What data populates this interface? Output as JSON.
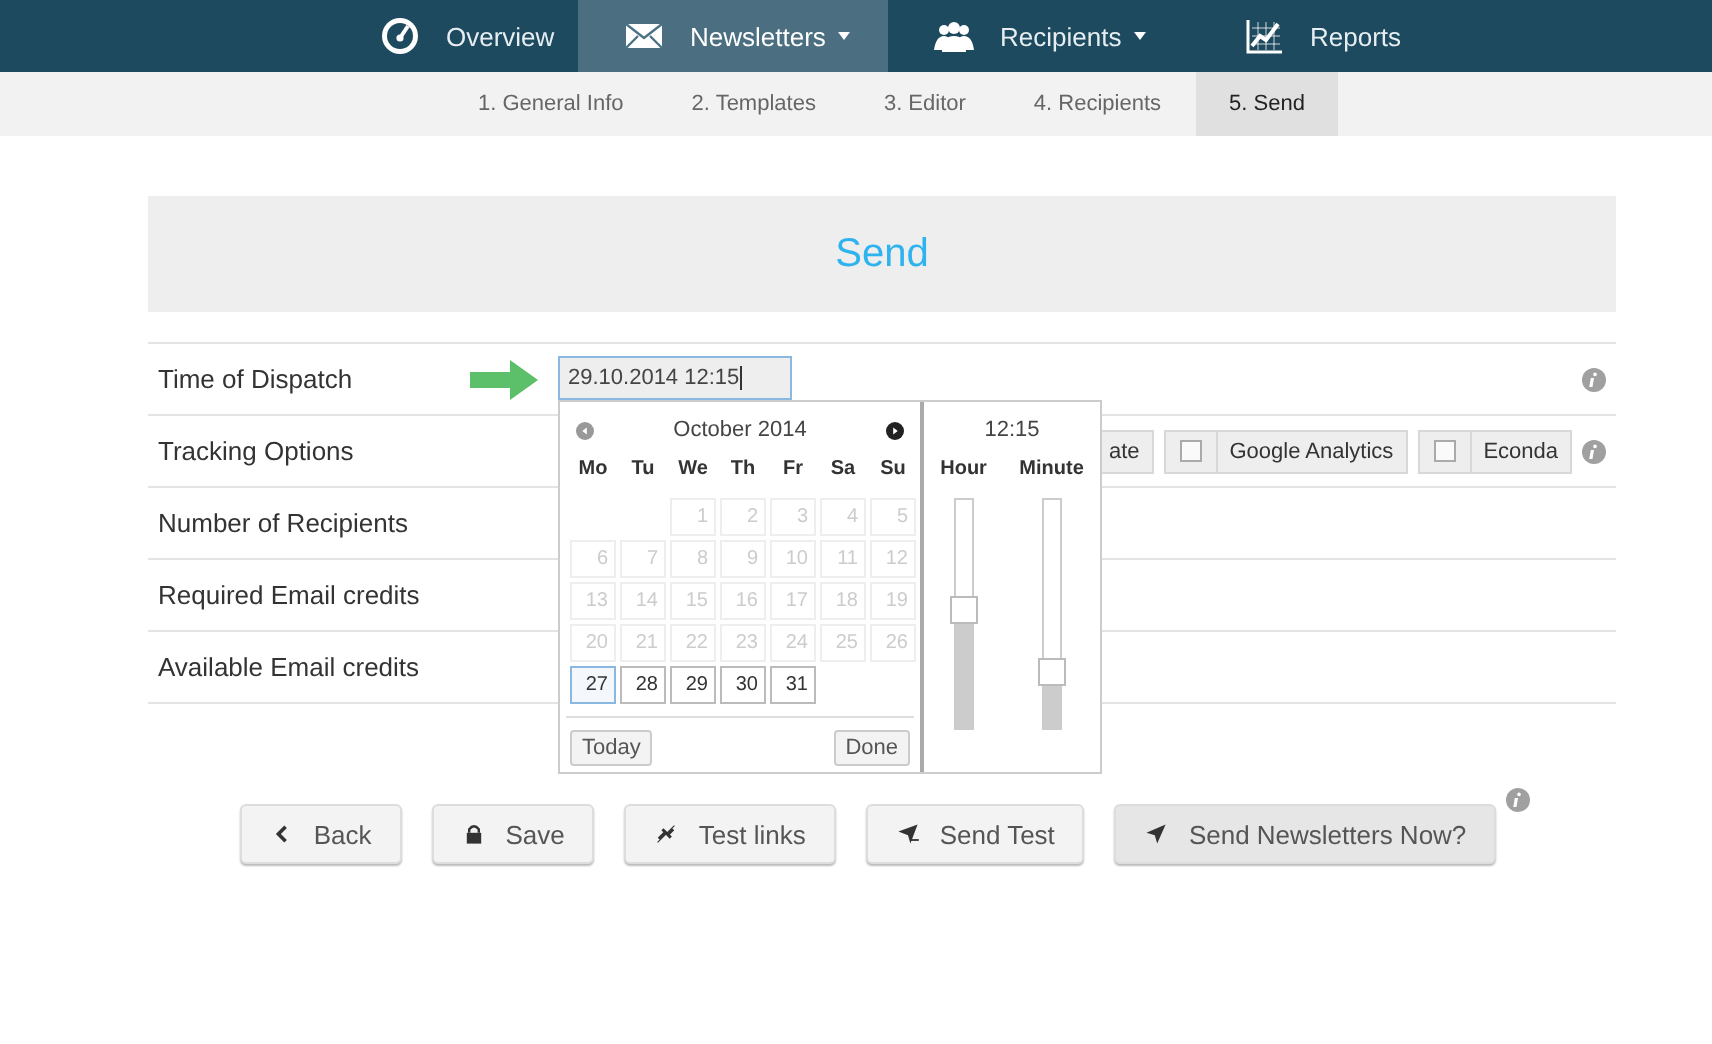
{
  "nav": [
    {
      "label": "Overview",
      "selected": false,
      "dropdown": false
    },
    {
      "label": "Newsletters",
      "selected": true,
      "dropdown": true
    },
    {
      "label": "Recipients",
      "selected": false,
      "dropdown": true
    },
    {
      "label": "Reports",
      "selected": false,
      "dropdown": false
    }
  ],
  "steps": [
    {
      "label": "1. General Info",
      "selected": false
    },
    {
      "label": "2. Templates",
      "selected": false
    },
    {
      "label": "3. Editor",
      "selected": false
    },
    {
      "label": "4. Recipients",
      "selected": false
    },
    {
      "label": "5. Send",
      "selected": true
    }
  ],
  "heading": "Send",
  "rows": [
    {
      "label": "Time of Dispatch",
      "kind": "datetime",
      "value": "29.10.2014 12:15",
      "info": true
    },
    {
      "label": "Tracking Options",
      "kind": "tracking",
      "options": [
        {
          "label": "ate",
          "kind": "partial"
        },
        {
          "label": "Google Analytics",
          "kind": "checkbox",
          "checked": false
        },
        {
          "label": "Econda",
          "kind": "checkbox",
          "checked": false
        }
      ],
      "info": true
    },
    {
      "label": "Number of Recipients",
      "kind": "plain",
      "info": false
    },
    {
      "label": "Required Email credits",
      "kind": "plain",
      "info": false
    },
    {
      "label": "Available Email credits",
      "kind": "plain",
      "info": false
    }
  ],
  "datepicker": {
    "month": "October 2014",
    "weekdays": [
      "Mo",
      "Tu",
      "We",
      "Th",
      "Fr",
      "Sa",
      "Su"
    ],
    "weeks": [
      [
        {
          "kind": "blank"
        },
        {
          "kind": "blank"
        },
        {
          "kind": "day",
          "label": "1",
          "disabled": true,
          "highlighted": false
        },
        {
          "kind": "day",
          "label": "2",
          "disabled": true,
          "highlighted": false
        },
        {
          "kind": "day",
          "label": "3",
          "disabled": true,
          "highlighted": false
        },
        {
          "kind": "day",
          "label": "4",
          "disabled": true,
          "highlighted": false
        },
        {
          "kind": "day",
          "label": "5",
          "disabled": true,
          "highlighted": false
        }
      ],
      [
        {
          "kind": "day",
          "label": "6",
          "disabled": true,
          "highlighted": false
        },
        {
          "kind": "day",
          "label": "7",
          "disabled": true,
          "highlighted": false
        },
        {
          "kind": "day",
          "label": "8",
          "disabled": true,
          "highlighted": false
        },
        {
          "kind": "day",
          "label": "9",
          "disabled": true,
          "highlighted": false
        },
        {
          "kind": "day",
          "label": "10",
          "disabled": true,
          "highlighted": false
        },
        {
          "kind": "day",
          "label": "11",
          "disabled": true,
          "highlighted": false
        },
        {
          "kind": "day",
          "label": "12",
          "disabled": true,
          "highlighted": false
        }
      ],
      [
        {
          "kind": "day",
          "label": "13",
          "disabled": true,
          "highlighted": false
        },
        {
          "kind": "day",
          "label": "14",
          "disabled": true,
          "highlighted": false
        },
        {
          "kind": "day",
          "label": "15",
          "disabled": true,
          "highlighted": false
        },
        {
          "kind": "day",
          "label": "16",
          "disabled": true,
          "highlighted": false
        },
        {
          "kind": "day",
          "label": "17",
          "disabled": true,
          "highlighted": false
        },
        {
          "kind": "day",
          "label": "18",
          "disabled": true,
          "highlighted": false
        },
        {
          "kind": "day",
          "label": "19",
          "disabled": true,
          "highlighted": false
        }
      ],
      [
        {
          "kind": "day",
          "label": "20",
          "disabled": true,
          "highlighted": false
        },
        {
          "kind": "day",
          "label": "21",
          "disabled": true,
          "highlighted": false
        },
        {
          "kind": "day",
          "label": "22",
          "disabled": true,
          "highlighted": false
        },
        {
          "kind": "day",
          "label": "23",
          "disabled": true,
          "highlighted": false
        },
        {
          "kind": "day",
          "label": "24",
          "disabled": true,
          "highlighted": false
        },
        {
          "kind": "day",
          "label": "25",
          "disabled": true,
          "highlighted": false
        },
        {
          "kind": "day",
          "label": "26",
          "disabled": true,
          "highlighted": false
        }
      ],
      [
        {
          "kind": "day",
          "label": "27",
          "disabled": false,
          "highlighted": true
        },
        {
          "kind": "day",
          "label": "28",
          "disabled": false,
          "highlighted": false
        },
        {
          "kind": "day",
          "label": "29",
          "disabled": false,
          "highlighted": false
        },
        {
          "kind": "day",
          "label": "30",
          "disabled": false,
          "highlighted": false
        },
        {
          "kind": "day",
          "label": "31",
          "disabled": false,
          "highlighted": false
        }
      ]
    ],
    "prev_disabled": true,
    "today_button": "Today",
    "done_button": "Done",
    "time": "12:15",
    "sliders": [
      {
        "label": "Hour",
        "level": 0.52
      },
      {
        "label": "Minute",
        "level": 0.25
      }
    ]
  },
  "buttons": [
    {
      "label": "Back",
      "primary": false
    },
    {
      "label": "Save",
      "primary": false
    },
    {
      "label": "Test links",
      "primary": false
    },
    {
      "label": "Send Test",
      "primary": false
    },
    {
      "label": "Send Newsletters Now?",
      "primary": true
    }
  ],
  "buttons_info": true
}
